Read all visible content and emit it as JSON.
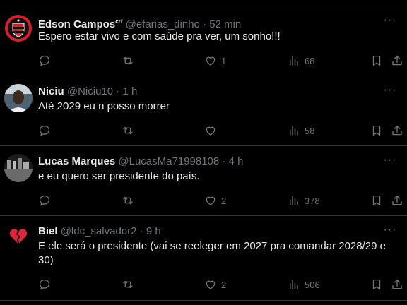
{
  "tweets": [
    {
      "name": "Edson Campos",
      "badge": "crf",
      "handle": "@efarias_dinho",
      "time": "52 min",
      "text": "Espero estar vivo e com saúde pra ver, um sonho!!!",
      "likes": "1",
      "views": "68",
      "avatar_icon": "club-crest-icon"
    },
    {
      "name": "Niciu",
      "handle": "@Niciu10",
      "time": "1 h",
      "text": "Até 2029 eu n posso morrer",
      "likes": "",
      "views": "58",
      "avatar_icon": "profile-photo"
    },
    {
      "name": "Lucas Marques",
      "handle": "@LucasMa71998108",
      "time": "4 h",
      "text": "e eu quero ser presidente do país.",
      "likes": "2",
      "views": "378",
      "avatar_icon": "profile-photo"
    },
    {
      "name": "Biel",
      "handle": "@ldc_salvador2",
      "time": "9 h",
      "text": "E ele será o presidente (vai se reeleger em 2027 pra comandar 2028/29 e 30)",
      "likes": "2",
      "views": "506",
      "avatar_icon": "broken-heart-icon"
    }
  ],
  "separator": "·",
  "colors": {
    "background": "#000000",
    "primary_text": "#e7e9ea",
    "secondary_text": "#71767b",
    "divider": "#2f3336",
    "crest_red": "#d8202a"
  }
}
